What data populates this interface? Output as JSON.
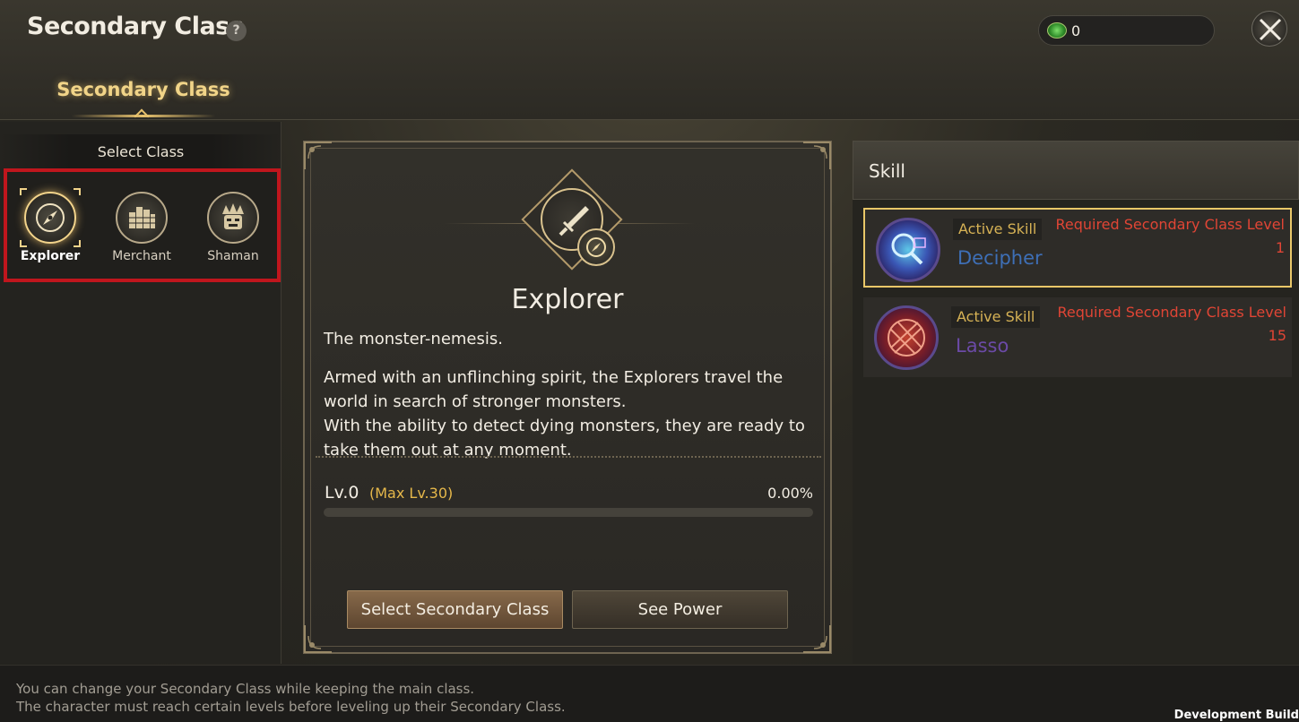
{
  "header": {
    "title": "Secondary Class",
    "help_icon": "?",
    "currency_icon": "green-gem-icon",
    "currency_value": "0",
    "close_icon": "close-x-icon"
  },
  "tabs": [
    {
      "label": "Secondary Class",
      "active": true
    }
  ],
  "left_panel": {
    "header": "Select Class",
    "classes": [
      {
        "name": "Explorer",
        "icon": "compass-icon",
        "selected": true
      },
      {
        "name": "Merchant",
        "icon": "coins-icon",
        "selected": false
      },
      {
        "name": "Shaman",
        "icon": "totem-mask-icon",
        "selected": false
      }
    ]
  },
  "class_detail": {
    "name": "Explorer",
    "emblem_icon": "dagger-icon",
    "badge_icon": "compass-icon",
    "tagline": "The monster-nemesis.",
    "description_1": "Armed with an unflinching spirit, the Explorers travel the world in search of stronger monsters.",
    "description_2": "With the ability to detect dying monsters, they are ready to take them out at any moment.",
    "level_text": "Lv.0",
    "max_level_text": "(Max Lv.30)",
    "progress_text": "0.00%",
    "progress": 0,
    "buttons": {
      "select": "Select Secondary Class",
      "power": "See Power"
    }
  },
  "skills": {
    "header": "Skill",
    "items": [
      {
        "type": "Active Skill",
        "name": "Decipher",
        "required_label": "Required Secondary Class Level",
        "required_level": "1",
        "icon": "decipher-magnifier-icon",
        "selected": true
      },
      {
        "type": "Active Skill",
        "name": "Lasso",
        "required_label": "Required Secondary Class Level",
        "required_level": "15",
        "icon": "lasso-net-icon",
        "selected": false
      }
    ]
  },
  "footer": {
    "line_1": "You can change your Secondary Class while keeping the main class.",
    "line_2": "The character must reach certain levels before leveling up their Secondary Class.",
    "build_label": "Development Build"
  },
  "colors": {
    "accent_gold": "#e6b84a",
    "selection_red": "#c0161d",
    "required_red": "#e04535",
    "decipher_blue": "#3e6fb6",
    "lasso_purple": "#6b4aa6"
  }
}
